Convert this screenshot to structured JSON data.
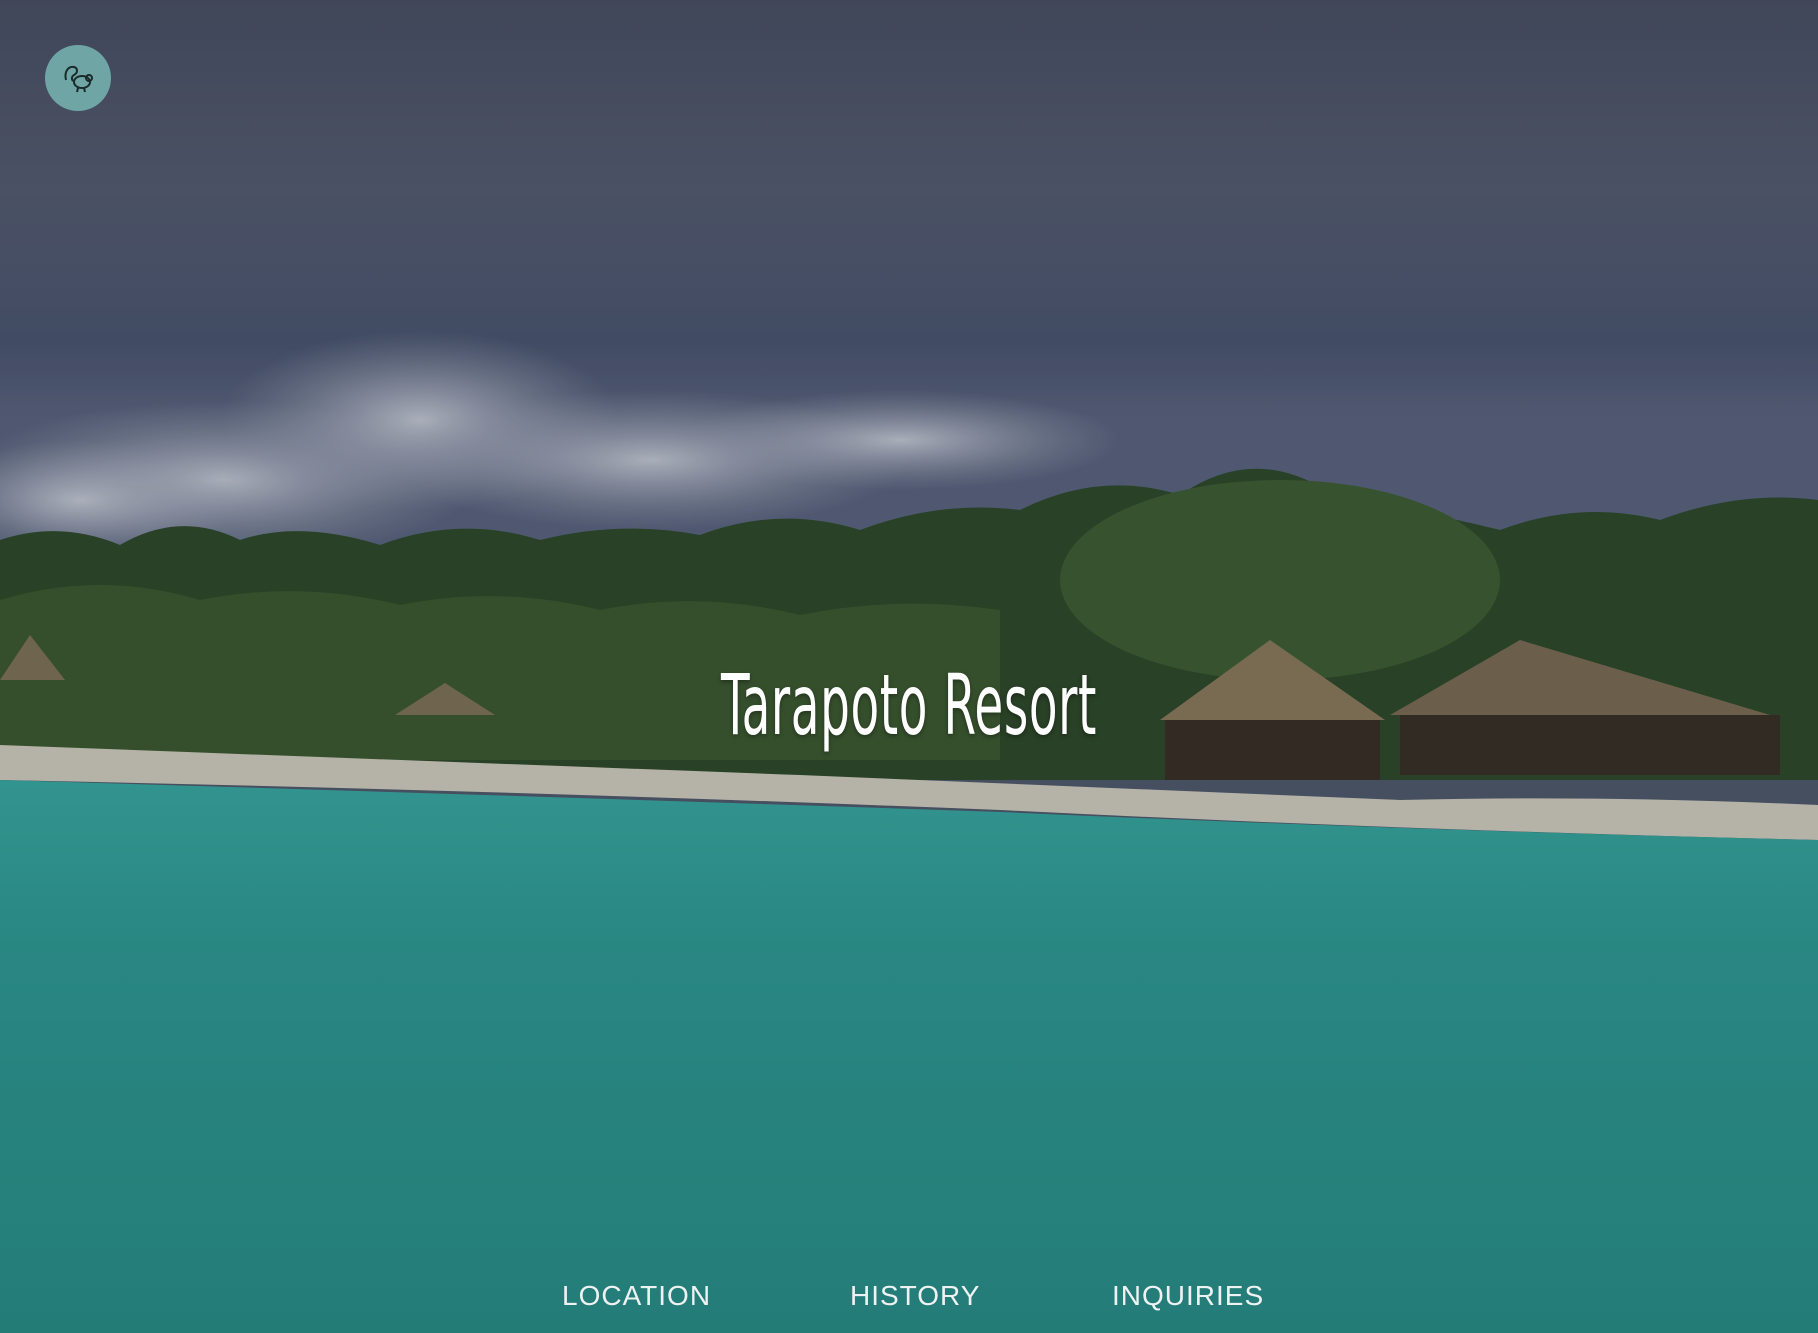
{
  "header": {
    "logo_icon": "squirrel-icon",
    "logo_bg": "#6fa6a5"
  },
  "hero": {
    "title": "Tarapoto Resort"
  },
  "nav": {
    "items": [
      {
        "label": "LOCATION"
      },
      {
        "label": "HISTORY"
      },
      {
        "label": "INQUIRIES"
      }
    ]
  },
  "colors": {
    "sky": "#4f5a6d",
    "sea": "#2e8f8a",
    "sand": "#d8d4c8",
    "text": "#ffffff"
  }
}
